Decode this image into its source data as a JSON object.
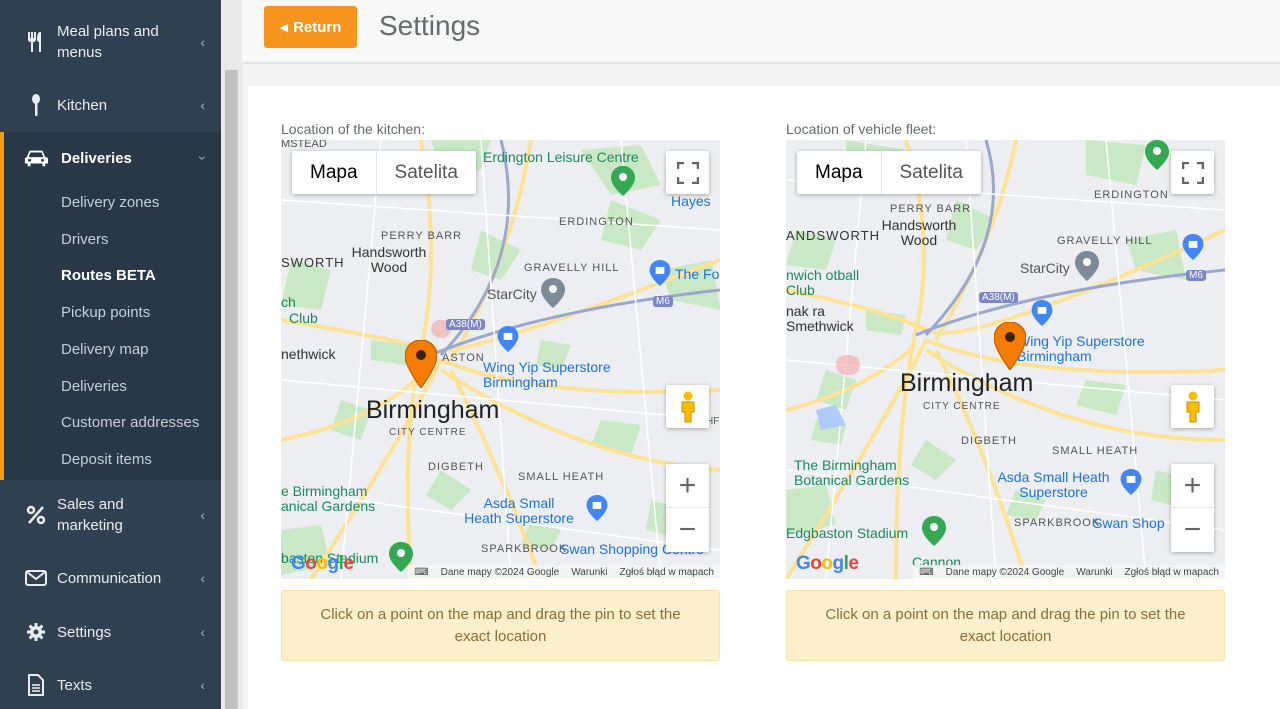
{
  "sidebar": {
    "items": [
      {
        "label": "Meal plans and menus",
        "icon": "fork-knife-icon"
      },
      {
        "label": "Kitchen",
        "icon": "spoon-icon"
      },
      {
        "label": "Deliveries",
        "icon": "car-icon"
      },
      {
        "label": "Sales and marketing",
        "icon": "percent-icon"
      },
      {
        "label": "Communication",
        "icon": "envelope-icon"
      },
      {
        "label": "Settings",
        "icon": "gear-icon"
      },
      {
        "label": "Texts",
        "icon": "document-icon"
      }
    ],
    "deliveries_sub": [
      "Delivery zones",
      "Drivers",
      "Routes BETA",
      "Pickup points",
      "Delivery map",
      "Deliveries",
      "Customer addresses",
      "Deposit items"
    ]
  },
  "header": {
    "return_label": "Return",
    "title": "Settings"
  },
  "maps": [
    {
      "label": "Location of the kitchen:",
      "toggle_map": "Mapa",
      "toggle_sat": "Satelita",
      "city": "Birmingham",
      "city_centre": "CITY CENTRE",
      "places": {
        "erdington_leisure": "Erdington Leisure Centre",
        "hayes": "Hayes",
        "erdington": "ERDINGTON",
        "perry_barr": "PERRY BARR",
        "handsworth_wood": "Handsworth Wood",
        "handsworth": "SWORTH",
        "gravelly_hill": "GRAVELLY HILL",
        "the_fo": "The Fo",
        "starcity": "StarCity",
        "club": "Club",
        "ch": "ch",
        "smethwick": "nethwick",
        "aston": "ASTON",
        "wing_yip": "Wing Yip Superstore Birmingham",
        "digbeth": "DIGBETH",
        "small_heath": "SMALL HEATH",
        "botanical": "e Birmingham anical Gardens",
        "asda": "Asda Small Heath Superstore",
        "stadium": "baston Stadium",
        "sparkbrook": "SPARKBROOK",
        "swan": "Swan Shopping Centre",
        "a38m": "A38(M)",
        "m6": "M6",
        "msted": "MSTEAD",
        "hf": "HF"
      },
      "attribution": [
        "Dane mapy ©2024 Google",
        "Warunki",
        "Zgłoś błąd w mapach"
      ]
    },
    {
      "label": "Location of vehicle fleet:",
      "toggle_map": "Mapa",
      "toggle_sat": "Satelita",
      "city": "Birmingham",
      "city_centre": "CITY CENTRE",
      "places": {
        "erdington": "ERDINGTON",
        "perry_barr": "PERRY BARR",
        "handsworth_wood": "Handsworth Wood",
        "handsworth": "ANDSWORTH",
        "gravelly_hill": "GRAVELLY HILL",
        "starcity": "StarCity",
        "football": "nwich otball Club",
        "smethwick": "nak ra Smethwick",
        "a38m": "A38(M)",
        "m6": "M6",
        "wing_yip": "Wing Yip Superstore Birmingham",
        "digbeth": "DIGBETH",
        "small_heath": "SMALL HEATH",
        "botanical": "The Birmingham Botanical Gardens",
        "asda": "Asda Small Heath Superstore",
        "stadium": "Edgbaston Stadium",
        "sparkbrook": "SPARKBROOK",
        "swan": "Swan Shop",
        "cannon": "Cannon"
      },
      "attribution": [
        "Dane mapy ©2024 Google",
        "Warunki",
        "Zgłoś błąd w mapach"
      ]
    }
  ],
  "notice": "Click on a point on the map and drag the pin to set the exact location",
  "colors": {
    "sidebar_bg": "#2f4050",
    "accent": "#f7941d",
    "notice_bg": "#fcf0cc",
    "pin": "#f57c00"
  }
}
